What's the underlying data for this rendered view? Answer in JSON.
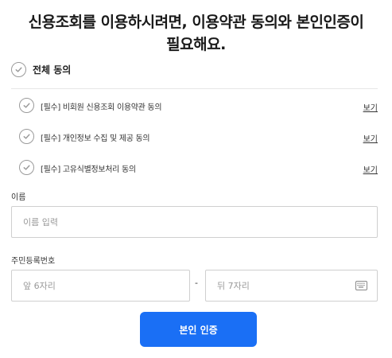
{
  "title": {
    "line1": "신용조회를 이용하시려면, 이용약관 동의와 본인인증이",
    "line2": "필요해요."
  },
  "agree_all": {
    "label": "전체 동의",
    "checked": false
  },
  "terms": [
    {
      "label": "[필수] 비회원 신용조회 이용약관 동의",
      "view": "보기"
    },
    {
      "label": "[필수] 개인정보 수집 및 제공 동의",
      "view": "보기"
    },
    {
      "label": "[필수] 고유식별정보처리 동의",
      "view": "보기"
    }
  ],
  "name_field": {
    "label": "이름",
    "placeholder": "이름 입력"
  },
  "rrn_field": {
    "label": "주민등록번호",
    "front_placeholder": "앞 6자리",
    "separator": "-",
    "back_placeholder": "뒤 7자리",
    "keypad_icon": "keypad-icon"
  },
  "submit": {
    "label": "본인 인증"
  },
  "colors": {
    "primary": "#1a6ff5",
    "check_border": "#9a9a9a",
    "input_border": "#cfcfcf"
  }
}
